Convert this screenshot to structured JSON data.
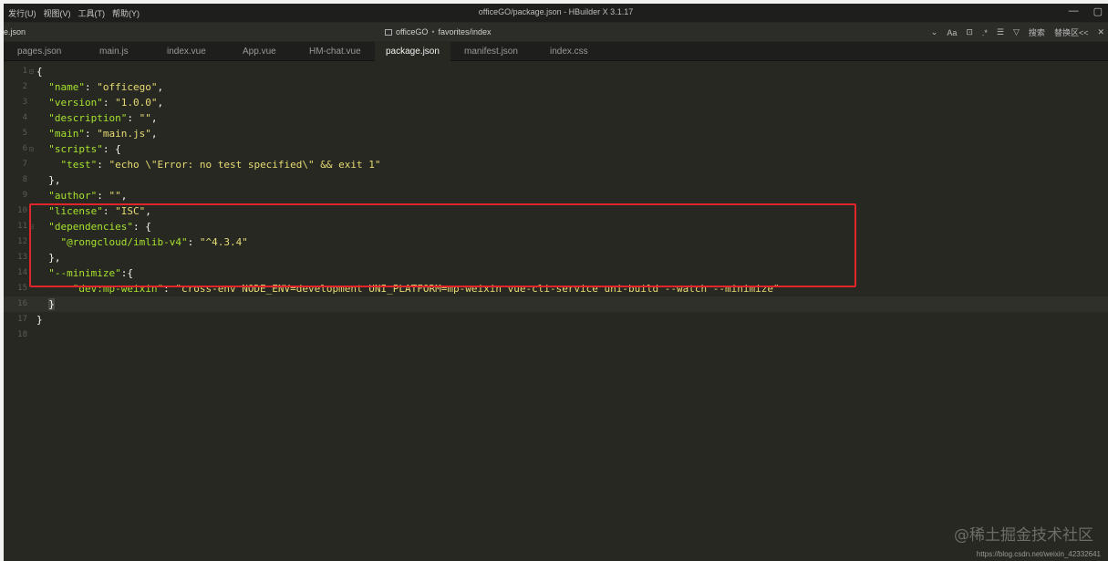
{
  "menu": {
    "items": [
      "发行(U)",
      "视图(V)",
      "工具(T)",
      "帮助(Y)"
    ]
  },
  "window": {
    "title": "officeGO/package.json - HBuilder X 3.1.17",
    "minimize": "—",
    "maximize": "▢"
  },
  "subbar": {
    "left_title": "e.json",
    "breadcrumb": {
      "project": "officeGO",
      "path": "favorites/index",
      "sep": "•"
    },
    "tools": [
      "⌄",
      "Aa",
      "⊡",
      ".*",
      "☰",
      "▽",
      "搜索",
      "替换区<<",
      "✕"
    ]
  },
  "tabs": [
    {
      "label": "pages.json",
      "active": false
    },
    {
      "label": "main.js",
      "active": false
    },
    {
      "label": "index.vue",
      "active": false
    },
    {
      "label": "App.vue",
      "active": false
    },
    {
      "label": "HM-chat.vue",
      "active": false
    },
    {
      "label": "package.json",
      "active": true
    },
    {
      "label": "manifest.json",
      "active": false
    },
    {
      "label": "index.css",
      "active": false
    }
  ],
  "editor": {
    "current_line": 16,
    "lines": [
      {
        "n": "1",
        "fold": "⊟",
        "tokens": [
          [
            "p",
            "{"
          ]
        ]
      },
      {
        "n": "2",
        "tokens": [
          [
            "p",
            "  "
          ],
          [
            "k",
            "\"name\""
          ],
          [
            "p",
            ": "
          ],
          [
            "s",
            "\"officego\""
          ],
          [
            "p",
            ","
          ]
        ]
      },
      {
        "n": "3",
        "tokens": [
          [
            "p",
            "  "
          ],
          [
            "k",
            "\"version\""
          ],
          [
            "p",
            ": "
          ],
          [
            "s",
            "\"1.0.0\""
          ],
          [
            "p",
            ","
          ]
        ]
      },
      {
        "n": "4",
        "tokens": [
          [
            "p",
            "  "
          ],
          [
            "k",
            "\"description\""
          ],
          [
            "p",
            ": "
          ],
          [
            "s",
            "\"\""
          ],
          [
            "p",
            ","
          ]
        ]
      },
      {
        "n": "5",
        "tokens": [
          [
            "p",
            "  "
          ],
          [
            "k",
            "\"main\""
          ],
          [
            "p",
            ": "
          ],
          [
            "s",
            "\"main.js\""
          ],
          [
            "p",
            ","
          ]
        ]
      },
      {
        "n": "6",
        "fold": "⊟",
        "tokens": [
          [
            "p",
            "  "
          ],
          [
            "k",
            "\"scripts\""
          ],
          [
            "p",
            ": {"
          ]
        ]
      },
      {
        "n": "7",
        "tokens": [
          [
            "p",
            "    "
          ],
          [
            "k",
            "\"test\""
          ],
          [
            "p",
            ": "
          ],
          [
            "s",
            "\"echo \\\"Error: no test specified\\\" && exit 1\""
          ]
        ]
      },
      {
        "n": "8",
        "tokens": [
          [
            "p",
            "  },"
          ]
        ]
      },
      {
        "n": "9",
        "tokens": [
          [
            "p",
            "  "
          ],
          [
            "k",
            "\"author\""
          ],
          [
            "p",
            ": "
          ],
          [
            "s",
            "\"\""
          ],
          [
            "p",
            ","
          ]
        ]
      },
      {
        "n": "10",
        "tokens": [
          [
            "p",
            "  "
          ],
          [
            "k",
            "\"license\""
          ],
          [
            "p",
            ": "
          ],
          [
            "s",
            "\"ISC\""
          ],
          [
            "p",
            ","
          ]
        ]
      },
      {
        "n": "11",
        "fold": "⊟",
        "tokens": [
          [
            "p",
            "  "
          ],
          [
            "k",
            "\"dependencies\""
          ],
          [
            "p",
            ": {"
          ]
        ]
      },
      {
        "n": "12",
        "tokens": [
          [
            "p",
            "    "
          ],
          [
            "k",
            "\"@rongcloud/imlib-v4\""
          ],
          [
            "p",
            ": "
          ],
          [
            "s",
            "\"^4.3.4\""
          ]
        ]
      },
      {
        "n": "13",
        "tokens": [
          [
            "p",
            "  },"
          ]
        ]
      },
      {
        "n": "14",
        "tokens": [
          [
            "p",
            "  "
          ],
          [
            "k",
            "\"--minimize\""
          ],
          [
            "p",
            ":{"
          ]
        ]
      },
      {
        "n": "15",
        "tokens": [
          [
            "p",
            "      "
          ],
          [
            "k",
            "\"dev:mp-weixin\""
          ],
          [
            "p",
            ": "
          ],
          [
            "s",
            "\"cross-env NODE_ENV=development UNI_PLATFORM=mp-weixin vue-cli-service uni-build --watch --minimize\""
          ]
        ]
      },
      {
        "n": "16",
        "tokens": [
          [
            "p",
            "  "
          ],
          [
            "c",
            "}"
          ]
        ]
      },
      {
        "n": "17",
        "tokens": [
          [
            "p",
            "}"
          ]
        ]
      },
      {
        "n": "18",
        "tokens": []
      }
    ]
  },
  "watermark": "@稀土掘金技术社区",
  "footer_url": "https://blog.csdn.net/weixin_42332641",
  "colors": {
    "highlight_border": "#e0262a",
    "editor_bg": "#272822",
    "key": "#a6e22e",
    "string": "#e6db74"
  }
}
